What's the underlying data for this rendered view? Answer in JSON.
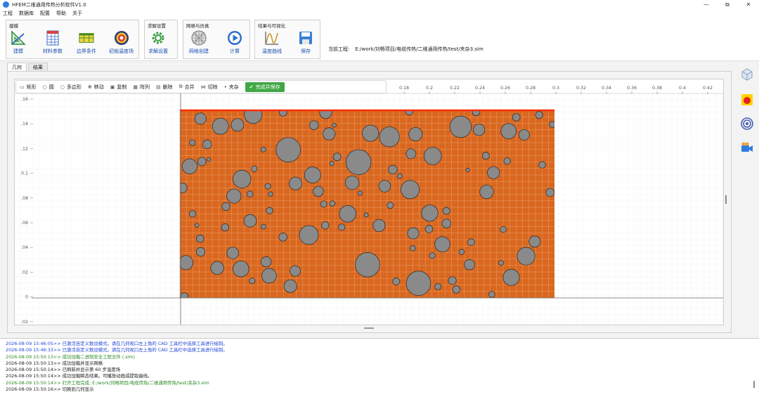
{
  "window": {
    "title": "HFEM二维通用传热分析软件V1.0",
    "minimize": "—",
    "maximize": "⧉",
    "close": "✕"
  },
  "menu": [
    "工程",
    "数据库",
    "配置",
    "帮助",
    "关于"
  ],
  "ribbon": {
    "groups": [
      {
        "title": "建模",
        "buttons": [
          "建模",
          "材料参数",
          "边界条件",
          "初始温度场"
        ]
      },
      {
        "title": "求解设置",
        "buttons": [
          "求解设置"
        ]
      },
      {
        "title": "网格与仿真",
        "buttons": [
          "网格创建",
          "计算"
        ]
      },
      {
        "title": "结果与可视化",
        "buttons": [
          "温度曲线",
          "保存"
        ]
      }
    ]
  },
  "project": {
    "label": "当前工程:",
    "path": "E:/work/刘畅项目/电缆传热/二维通用传热/test/夹杂3.sim"
  },
  "tabs": [
    {
      "label": "几何",
      "active": true
    },
    {
      "label": "结果",
      "active": false
    }
  ],
  "cad_toolbar": {
    "buttons": [
      {
        "icon": "rectangle-icon",
        "glyph": "▭",
        "label": "矩形"
      },
      {
        "icon": "circle-icon",
        "glyph": "○",
        "label": "圆"
      },
      {
        "icon": "polygon-icon",
        "glyph": "○",
        "label": "多边形"
      },
      {
        "icon": "move-icon",
        "glyph": "✥",
        "label": "移动"
      },
      {
        "icon": "copy-icon",
        "glyph": "▣",
        "label": "复制"
      },
      {
        "icon": "array-icon",
        "glyph": "▦",
        "label": "阵列"
      },
      {
        "icon": "delete-icon",
        "glyph": "▤",
        "label": "删除"
      },
      {
        "icon": "merge-icon",
        "glyph": "⧉",
        "label": "合并"
      },
      {
        "icon": "cut-icon",
        "glyph": "⋈",
        "label": "切除"
      },
      {
        "icon": "inclusion-icon",
        "glyph": "•",
        "label": "夹杂"
      }
    ],
    "done": "完成并保存"
  },
  "plot": {
    "x_ticks": [
      "0.18",
      "0.2",
      "0.22",
      "0.24",
      "0.26",
      "0.28",
      "0.3",
      "0.32",
      "0.34",
      "0.36",
      "0.38",
      "0.4",
      "0.42"
    ],
    "y_ticks": [
      ".16",
      ".14",
      ".12",
      "0.1",
      ".08",
      ".06",
      ".04",
      ".02",
      "0",
      ".02"
    ],
    "domain_color": "#d9671f",
    "inclusion_color": "#8a8a8a",
    "boundary_color": "#ff2a00"
  },
  "right_panel": [
    "cube-icon",
    "heat-icon",
    "contour-icon",
    "camera-icon"
  ],
  "log": [
    {
      "type": "blue",
      "text": "2026-08-09 15:46:05>> 已激活自定义数设模式。请在几何视口左上角的 CAD 工具栏中选择工具进行绘制。"
    },
    {
      "type": "blue",
      "text": "2026-08-09 15:46:33>> 已激活自定义数设模式。请在几何视口左上角的 CAD 工具栏中选择工具进行绘制。"
    },
    {
      "type": "green",
      "text": "2026-08-09 15:50:13>> 成功加载二进制安全工程文件 (.sim)"
    },
    {
      "type": "black",
      "text": "2026-08-09 15:50:13>> 成功加载并显示网格"
    },
    {
      "type": "black",
      "text": "2026-08-09 15:50:14>> 已刷新并显示第 60 步温度场"
    },
    {
      "type": "black",
      "text": "2026-08-09 15:50:14>> 成功加载瞬态结果。可播放动画或提取曲线。"
    },
    {
      "type": "green",
      "text": "2026-08-09 15:50:14>> 打开工程完成: E:/work/刘畅项目/电缆传热/二维通用传热/test/夹杂3.sim"
    },
    {
      "type": "black",
      "text": "2026-08-09 15:50:16>> 切换到几何显示"
    }
  ]
}
